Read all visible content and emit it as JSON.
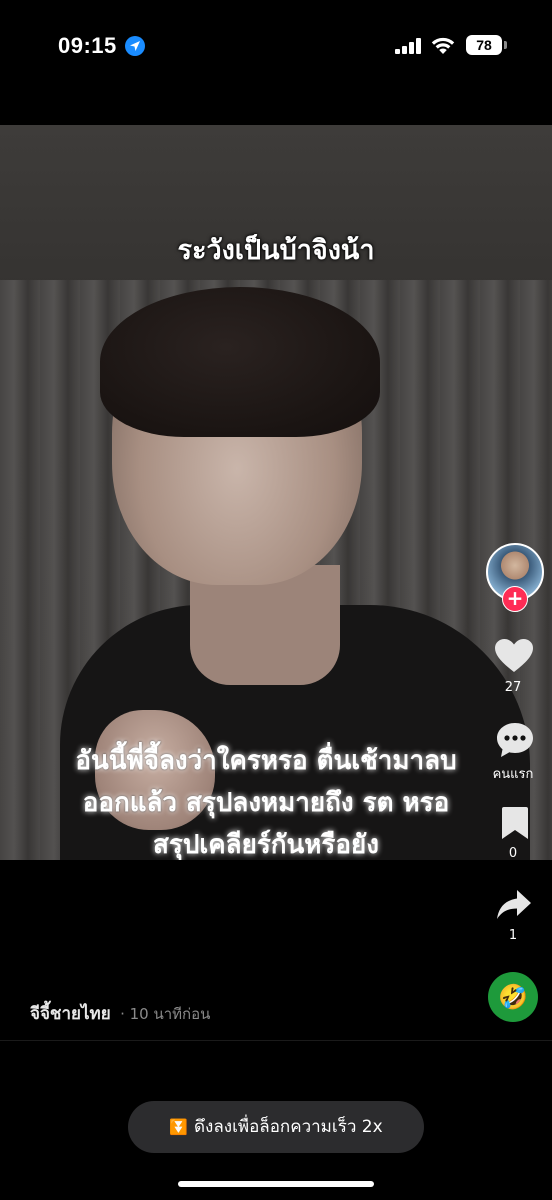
{
  "status_bar": {
    "time": "09:15",
    "battery": "78",
    "icons": [
      "location-arrow-icon",
      "signal-icon",
      "wifi-icon",
      "battery-icon"
    ]
  },
  "video": {
    "caption_top": "ระวังเป็นบ้าจิงน้า",
    "caption_bottom": "อันนี้พี่จี้ลงว่าใครหรอ ตื่นเช้ามาลบออกแล้ว สรุปลงหมายถึง รต หรอ สรุปเคลียร์กันหรือยัง"
  },
  "actions": {
    "likes": "27",
    "comments": "คนแรก",
    "saves": "0",
    "shares": "1",
    "follow_symbol": "+"
  },
  "post": {
    "author": "จีจี้ชายไทย",
    "time_ago": "· 10 นาทีก่อน",
    "sound_emoji": "🤣"
  },
  "speed_hint": {
    "label": "ดึงลงเพื่อล็อกความเร็ว 2x"
  },
  "colors": {
    "accent_red": "#fe2c55",
    "location_blue": "#1a8cff",
    "pill_bg": "#2c2c2e"
  }
}
